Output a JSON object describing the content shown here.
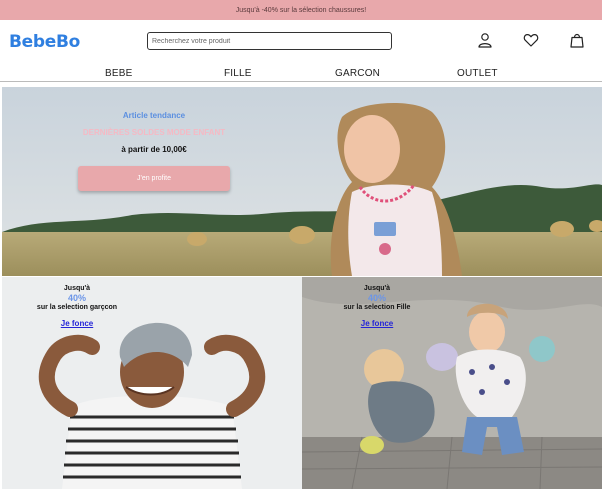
{
  "promo_bar": {
    "text": "Jusqu'à -40% sur la sélection chaussures!"
  },
  "header": {
    "logo": "BebeBo",
    "search_placeholder": "Recherchez votre produit",
    "icons": [
      "user-icon",
      "heart-icon",
      "bag-icon"
    ]
  },
  "nav": {
    "items": [
      "BEBE",
      "FILLE",
      "GARCON",
      "OUTLET"
    ]
  },
  "hero": {
    "eyebrow": "Article tendance",
    "title": "DERNIÈRES SOLDES MODE ENFANT",
    "price": "à partir de 10,00€",
    "button": "J'en profite"
  },
  "tiles": [
    {
      "line1": "Jusqu'à",
      "discount": "40%",
      "line3": "sur la selection garçcon",
      "cta": "Je fonce"
    },
    {
      "line1": "Jusqu'à",
      "discount": "40%",
      "line3": "sur la selection Fille",
      "cta": "Je fonce"
    }
  ],
  "colors": {
    "promo": "#e8a8ab",
    "accent_blue": "#2f7fe0",
    "discount_blue": "#6b95e8",
    "link_blue": "#2424d8",
    "pink_title": "#f5b9c4"
  }
}
